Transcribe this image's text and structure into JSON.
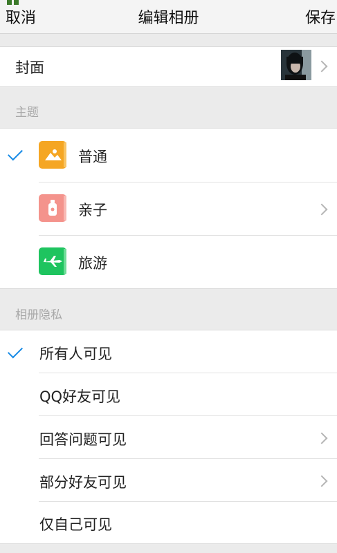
{
  "nav": {
    "cancel": "取消",
    "title": "编辑相册",
    "save": "保存"
  },
  "cover": {
    "label": "封面"
  },
  "theme": {
    "section_title": "主题",
    "items": [
      {
        "label": "普通",
        "selected": true,
        "chevron": false,
        "icon": "landscape-photo-icon",
        "color": "#f5a623"
      },
      {
        "label": "亲子",
        "selected": false,
        "chevron": true,
        "icon": "baby-bottle-icon",
        "color": "#f4938c"
      },
      {
        "label": "旅游",
        "selected": false,
        "chevron": false,
        "icon": "airplane-icon",
        "color": "#1ec45f"
      }
    ]
  },
  "privacy": {
    "section_title": "相册隐私",
    "items": [
      {
        "label": "所有人可见",
        "selected": true,
        "chevron": false
      },
      {
        "label": "QQ好友可见",
        "selected": false,
        "chevron": false
      },
      {
        "label": "回答问题可见",
        "selected": false,
        "chevron": true
      },
      {
        "label": "部分好友可见",
        "selected": false,
        "chevron": true
      },
      {
        "label": "仅自己可见",
        "selected": false,
        "chevron": false
      }
    ]
  },
  "colors": {
    "accent": "#1a8ce6",
    "background": "#ebebeb"
  }
}
